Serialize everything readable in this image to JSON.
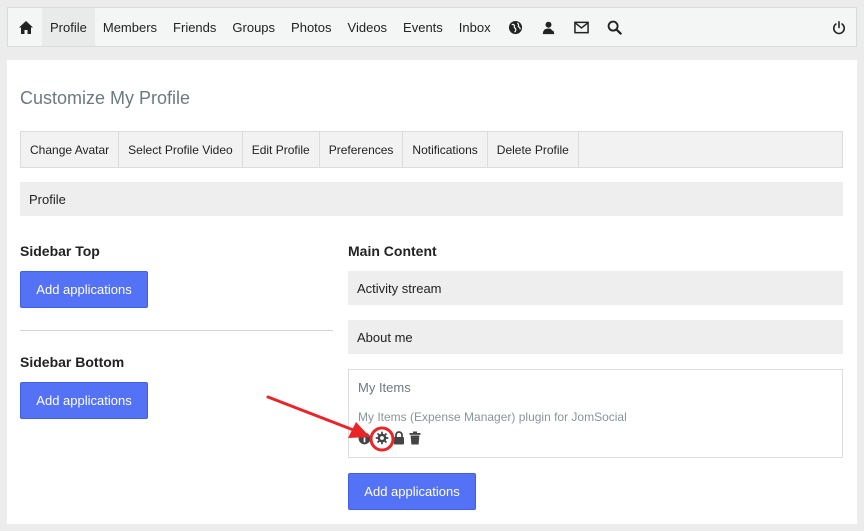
{
  "topnav": {
    "items": [
      "Profile",
      "Members",
      "Friends",
      "Groups",
      "Photos",
      "Videos",
      "Events",
      "Inbox"
    ],
    "icons": [
      "home-icon",
      "globe-icon",
      "friend-requests-icon",
      "mail-icon",
      "search-icon",
      "power-icon"
    ]
  },
  "page": {
    "title": "Customize My Profile"
  },
  "subnav": {
    "items": [
      "Change Avatar",
      "Select Profile Video",
      "Edit Profile",
      "Preferences",
      "Notifications",
      "Delete Profile"
    ]
  },
  "profile_bar": {
    "label": "Profile"
  },
  "sidebar_top": {
    "heading": "Sidebar Top",
    "button": "Add applications"
  },
  "sidebar_bottom": {
    "heading": "Sidebar Bottom",
    "button": "Add applications"
  },
  "main_content": {
    "heading": "Main Content",
    "apps": [
      "Activity stream",
      "About me"
    ],
    "my_items": {
      "title": "My Items",
      "description": "My Items (Expense Manager) plugin for JomSocial",
      "icons": [
        "info-icon",
        "gear-icon",
        "lock-icon",
        "trash-icon"
      ]
    },
    "button": "Add applications"
  },
  "colors": {
    "accent": "#5472f5",
    "annotation": "#e8262a"
  }
}
